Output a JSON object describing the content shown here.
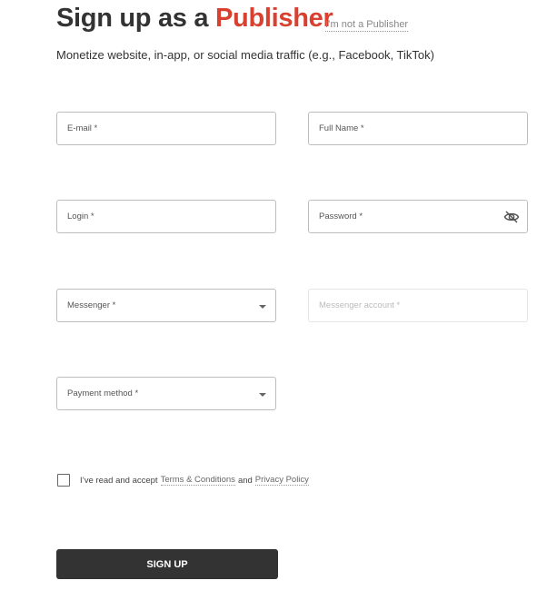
{
  "header": {
    "title_prefix": "Sign up as a ",
    "title_accent": "Publisher",
    "not_publisher_link": "I’m not a Publisher",
    "subtitle": "Monetize website, in-app, or social media traffic (e.g., Facebook, TikTok)"
  },
  "form": {
    "email": {
      "label": "E-mail *",
      "value": ""
    },
    "full_name": {
      "label": "Full Name *",
      "value": ""
    },
    "login": {
      "label": "Login *",
      "value": ""
    },
    "password": {
      "label": "Password *",
      "value": "",
      "icon": "eye-off-icon"
    },
    "messenger": {
      "label": "Messenger *",
      "selected": ""
    },
    "messenger_account": {
      "label": "Messenger account *",
      "value": "",
      "disabled": true
    },
    "payment_method": {
      "label": "Payment method *",
      "selected": ""
    },
    "terms": {
      "checked": false,
      "text_prefix": "I’ve read and accept",
      "terms_link": "Terms & Conditions",
      "and": "and",
      "privacy_link": "Privacy Policy"
    },
    "submit_label": "SIGN UP"
  },
  "colors": {
    "accent": "#d8412f",
    "button_bg": "#333333"
  }
}
